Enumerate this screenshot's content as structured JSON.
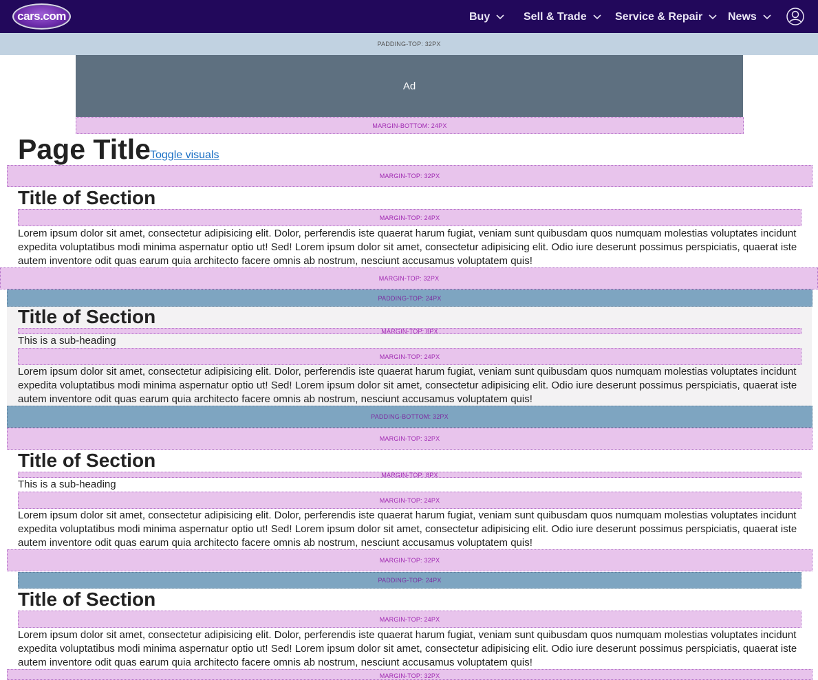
{
  "header": {
    "logo_text": "cars.com",
    "nav": [
      {
        "label": "Buy"
      },
      {
        "label": "Sell & Trade"
      },
      {
        "label": "Service & Repair"
      },
      {
        "label": "News"
      }
    ],
    "icons": {
      "chevron": "chevron-down-icon",
      "user": "user-account-icon"
    },
    "colors": {
      "nav_bg": "#22085b",
      "guide_margin": "#e8c4ec",
      "guide_padding": "#7ea5c1",
      "link": "#1a6fc4"
    }
  },
  "guides": {
    "padding_top_32": "PADDING-TOP: 32PX",
    "margin_bottom_24": "MARGIN-BOTTOM: 24PX",
    "margin_top_32": "MARGIN-TOP: 32PX",
    "margin_top_24": "MARGIN-TOP: 24PX",
    "padding_top_24": "PADDING-TOP: 24PX",
    "margin_top_8": "MARGIN-TOP: 8PX",
    "padding_bottom_32": "PADDING-BOTTOM: 32PX"
  },
  "ad": {
    "label": "Ad"
  },
  "page": {
    "title": "Page Title",
    "toggle_link": "Toggle visuals"
  },
  "sections": [
    {
      "title": "Title of Section",
      "subheading": "",
      "body": "Lorem ipsum dolor sit amet, consectetur adipisicing elit. Dolor, perferendis iste quaerat harum fugiat, veniam sunt quibusdam quos numquam molestias voluptates incidunt expedita voluptatibus modi minima aspernatur optio ut! Sed! Lorem ipsum dolor sit amet, consectetur adipisicing elit. Odio iure deserunt possimus perspiciatis, quaerat iste autem inventore odit quas earum quia architecto facere omnis ab nostrum, nesciunt accusamus voluptatem quis!"
    },
    {
      "title": "Title of Section",
      "subheading": "This is a sub-heading",
      "body": "Lorem ipsum dolor sit amet, consectetur adipisicing elit. Dolor, perferendis iste quaerat harum fugiat, veniam sunt quibusdam quos numquam molestias voluptates incidunt expedita voluptatibus modi minima aspernatur optio ut! Sed! Lorem ipsum dolor sit amet, consectetur adipisicing elit. Odio iure deserunt possimus perspiciatis, quaerat iste autem inventore odit quas earum quia architecto facere omnis ab nostrum, nesciunt accusamus voluptatem quis!"
    },
    {
      "title": "Title of Section",
      "subheading": "This is a sub-heading",
      "body": "Lorem ipsum dolor sit amet, consectetur adipisicing elit. Dolor, perferendis iste quaerat harum fugiat, veniam sunt quibusdam quos numquam molestias voluptates incidunt expedita voluptatibus modi minima aspernatur optio ut! Sed! Lorem ipsum dolor sit amet, consectetur adipisicing elit. Odio iure deserunt possimus perspiciatis, quaerat iste autem inventore odit quas earum quia architecto facere omnis ab nostrum, nesciunt accusamus voluptatem quis!"
    },
    {
      "title": "Title of Section",
      "subheading": "",
      "body": "Lorem ipsum dolor sit amet, consectetur adipisicing elit. Dolor, perferendis iste quaerat harum fugiat, veniam sunt quibusdam quos numquam molestias voluptates incidunt expedita voluptatibus modi minima aspernatur optio ut! Sed! Lorem ipsum dolor sit amet, consectetur adipisicing elit. Odio iure deserunt possimus perspiciatis, quaerat iste autem inventore odit quas earum quia architecto facere omnis ab nostrum, nesciunt accusamus voluptatem quis!"
    }
  ]
}
